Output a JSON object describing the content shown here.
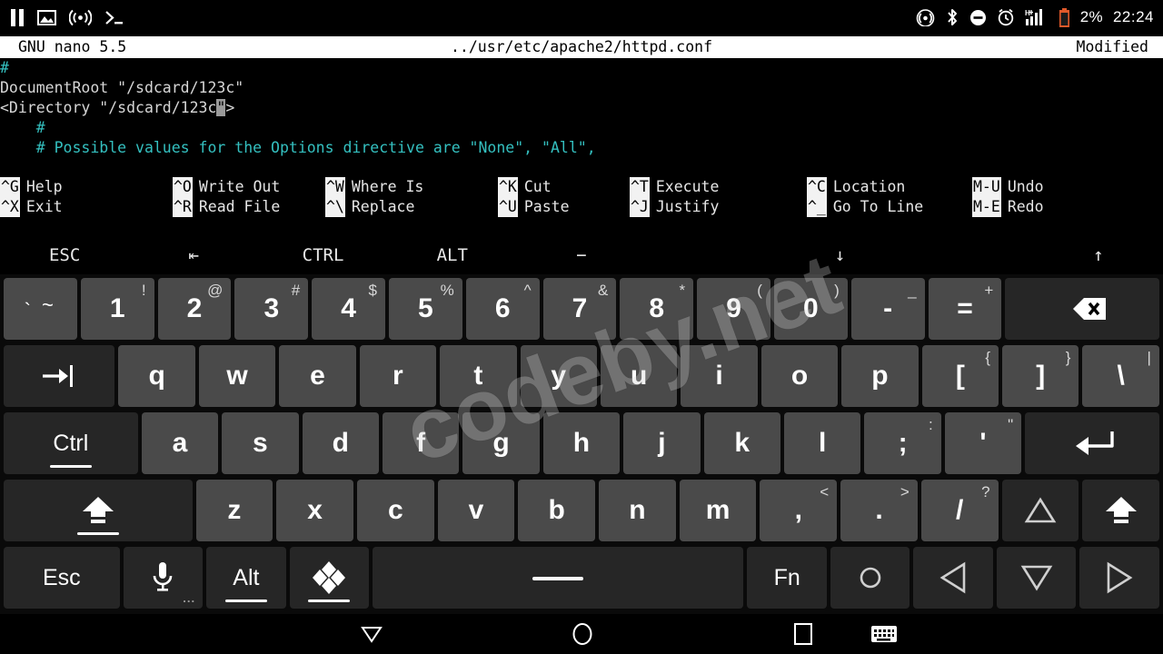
{
  "statusbar": {
    "left_icons": [
      "pause-icon",
      "image-icon",
      "broadcast-icon",
      "terminal-icon"
    ],
    "right_icons": [
      "location-icon",
      "bluetooth-icon",
      "do-not-disturb-icon",
      "alarm-icon",
      "signal-hplus-icon",
      "battery-icon"
    ],
    "battery_percent": "2%",
    "clock": "22:24",
    "battery_color": "#e0592a"
  },
  "nano": {
    "version_label": "GNU nano 5.5",
    "file_path": "../usr/etc/apache2/httpd.conf",
    "modified_label": "Modified",
    "comment_color": "#34c0c0",
    "lines": [
      {
        "type": "comment",
        "text": "#"
      },
      {
        "type": "code",
        "text": "DocumentRoot \"/sdcard/123c\""
      },
      {
        "type": "code_cursor",
        "before": "<Directory \"/sdcard/123c",
        "cursor": "\"",
        "after": ">"
      },
      {
        "type": "comment",
        "text": "    #"
      },
      {
        "type": "comment",
        "text": "    # Possible values for the Options directive are \"None\", \"All\","
      }
    ],
    "shortcuts_row1": [
      {
        "key": "^G",
        "label": "Help"
      },
      {
        "key": "^O",
        "label": "Write Out"
      },
      {
        "key": "^W",
        "label": "Where Is"
      },
      {
        "key": "^K",
        "label": "Cut"
      },
      {
        "key": "^T",
        "label": "Execute"
      },
      {
        "key": "^C",
        "label": "Location"
      },
      {
        "key": "M-U",
        "label": "Undo"
      }
    ],
    "shortcuts_row2": [
      {
        "key": "^X",
        "label": "Exit"
      },
      {
        "key": "^R",
        "label": "Read File"
      },
      {
        "key": "^\\",
        "label": "Replace"
      },
      {
        "key": "^U",
        "label": "Paste"
      },
      {
        "key": "^J",
        "label": "Justify"
      },
      {
        "key": "^_",
        "label": "Go To Line"
      },
      {
        "key": "M-E",
        "label": "Redo"
      }
    ]
  },
  "extra_row": [
    {
      "label": "ESC",
      "name": "extrakey-esc"
    },
    {
      "label": "⇤",
      "name": "extrakey-tab"
    },
    {
      "label": "CTRL",
      "name": "extrakey-ctrl"
    },
    {
      "label": "ALT",
      "name": "extrakey-alt"
    },
    {
      "label": "−",
      "name": "extrakey-minus"
    },
    {
      "label": "",
      "name": "extrakey-blank"
    },
    {
      "label": "↓",
      "name": "extrakey-down"
    },
    {
      "label": "",
      "name": "extrakey-blank2"
    },
    {
      "label": "↑",
      "name": "extrakey-up"
    }
  ],
  "keyboard": {
    "row1": [
      {
        "name": "key-backtick",
        "main": "`",
        "sup": "~",
        "style": "tilde"
      },
      {
        "name": "key-1",
        "main": "1",
        "sup": "!"
      },
      {
        "name": "key-2",
        "main": "2",
        "sup": "@"
      },
      {
        "name": "key-3",
        "main": "3",
        "sup": "#"
      },
      {
        "name": "key-4",
        "main": "4",
        "sup": "$"
      },
      {
        "name": "key-5",
        "main": "5",
        "sup": "%"
      },
      {
        "name": "key-6",
        "main": "6",
        "sup": "^"
      },
      {
        "name": "key-7",
        "main": "7",
        "sup": "&"
      },
      {
        "name": "key-8",
        "main": "8",
        "sup": "*"
      },
      {
        "name": "key-9",
        "main": "9",
        "sup": "("
      },
      {
        "name": "key-0",
        "main": "0",
        "sup": ")"
      },
      {
        "name": "key-minus",
        "main": "-",
        "sup": "_"
      },
      {
        "name": "key-equals",
        "main": "=",
        "sup": "+"
      },
      {
        "name": "key-backspace",
        "main": "",
        "sup": "",
        "icon": "backspace-icon",
        "dark": true,
        "flex": 2.1
      }
    ],
    "row2": [
      {
        "name": "key-tab",
        "main": "",
        "icon": "tab-icon",
        "dark": true,
        "flex": 1.45
      },
      {
        "name": "key-q",
        "main": "q"
      },
      {
        "name": "key-w",
        "main": "w"
      },
      {
        "name": "key-e",
        "main": "e"
      },
      {
        "name": "key-r",
        "main": "r"
      },
      {
        "name": "key-t",
        "main": "t"
      },
      {
        "name": "key-y",
        "main": "y"
      },
      {
        "name": "key-u",
        "main": "u"
      },
      {
        "name": "key-i",
        "main": "i"
      },
      {
        "name": "key-o",
        "main": "o"
      },
      {
        "name": "key-p",
        "main": "p"
      },
      {
        "name": "key-bracketleft",
        "main": "[",
        "sup": "{"
      },
      {
        "name": "key-bracketright",
        "main": "]",
        "sup": "}"
      },
      {
        "name": "key-backslash",
        "main": "\\",
        "sup": "|"
      }
    ],
    "row3": [
      {
        "name": "key-ctrl",
        "label": "Ctrl",
        "dark": true,
        "underbar": true,
        "flex": 1.75
      },
      {
        "name": "key-a",
        "main": "a"
      },
      {
        "name": "key-s",
        "main": "s"
      },
      {
        "name": "key-d",
        "main": "d"
      },
      {
        "name": "key-f",
        "main": "f"
      },
      {
        "name": "key-g",
        "main": "g"
      },
      {
        "name": "key-h",
        "main": "h"
      },
      {
        "name": "key-j",
        "main": "j"
      },
      {
        "name": "key-k",
        "main": "k"
      },
      {
        "name": "key-l",
        "main": "l"
      },
      {
        "name": "key-semicolon",
        "main": ";",
        "sup": ":"
      },
      {
        "name": "key-quote",
        "main": "'",
        "sup": "\""
      },
      {
        "name": "key-enter",
        "main": "",
        "icon": "enter-icon",
        "dark": true,
        "flex": 1.75
      }
    ],
    "row4": [
      {
        "name": "key-shift-left",
        "main": "",
        "icon": "shift-icon",
        "dark": true,
        "underbar": true,
        "flex": 2.45
      },
      {
        "name": "key-z",
        "main": "z"
      },
      {
        "name": "key-x",
        "main": "x"
      },
      {
        "name": "key-c",
        "main": "c"
      },
      {
        "name": "key-v",
        "main": "v"
      },
      {
        "name": "key-b",
        "main": "b"
      },
      {
        "name": "key-n",
        "main": "n"
      },
      {
        "name": "key-m",
        "main": "m"
      },
      {
        "name": "key-comma",
        "main": ",",
        "sup": "<"
      },
      {
        "name": "key-period",
        "main": ".",
        "sup": ">"
      },
      {
        "name": "key-slash",
        "main": "/",
        "sup": "?"
      },
      {
        "name": "key-arrow-up",
        "main": "",
        "icon": "arrow-up-outline-icon",
        "dark": true
      },
      {
        "name": "key-shift-right",
        "main": "",
        "icon": "shift-icon",
        "dark": true
      }
    ],
    "row5": [
      {
        "name": "key-esc",
        "label": "Esc",
        "dark": true,
        "flex": 1.75
      },
      {
        "name": "key-mic",
        "main": "",
        "icon": "mic-icon",
        "dark": true,
        "dots": "...",
        "flex": 1.2
      },
      {
        "name": "key-alt",
        "label": "Alt",
        "dark": true,
        "underbar": true,
        "flex": 1.2
      },
      {
        "name": "key-symbols",
        "main": "",
        "icon": "diamonds-icon",
        "dark": true,
        "underbar": true,
        "flex": 1.2
      },
      {
        "name": "key-space",
        "main": "",
        "icon": "space-icon",
        "dark": true,
        "flex": 5.6
      },
      {
        "name": "key-fn",
        "label": "Fn",
        "dark": true,
        "flex": 1.2
      },
      {
        "name": "key-circle",
        "main": "",
        "icon": "circle-icon",
        "dark": true,
        "flex": 1.2
      },
      {
        "name": "key-arrow-left",
        "main": "",
        "icon": "arrow-left-outline-icon",
        "dark": true,
        "flex": 1.2
      },
      {
        "name": "key-arrow-down",
        "main": "",
        "icon": "arrow-down-outline-icon",
        "dark": true,
        "flex": 1.2
      },
      {
        "name": "key-arrow-right",
        "main": "",
        "icon": "arrow-right-outline-icon",
        "dark": true,
        "flex": 1.2
      }
    ]
  },
  "navbar": {
    "items": [
      {
        "name": "nav-back-icon",
        "glyph": "down-triangle"
      },
      {
        "name": "nav-home-icon",
        "glyph": "circle"
      },
      {
        "name": "nav-recents-icon",
        "glyph": "square"
      },
      {
        "name": "nav-keyboard-icon",
        "glyph": "keyboard"
      }
    ]
  },
  "watermark": {
    "text": "codeby.net"
  }
}
